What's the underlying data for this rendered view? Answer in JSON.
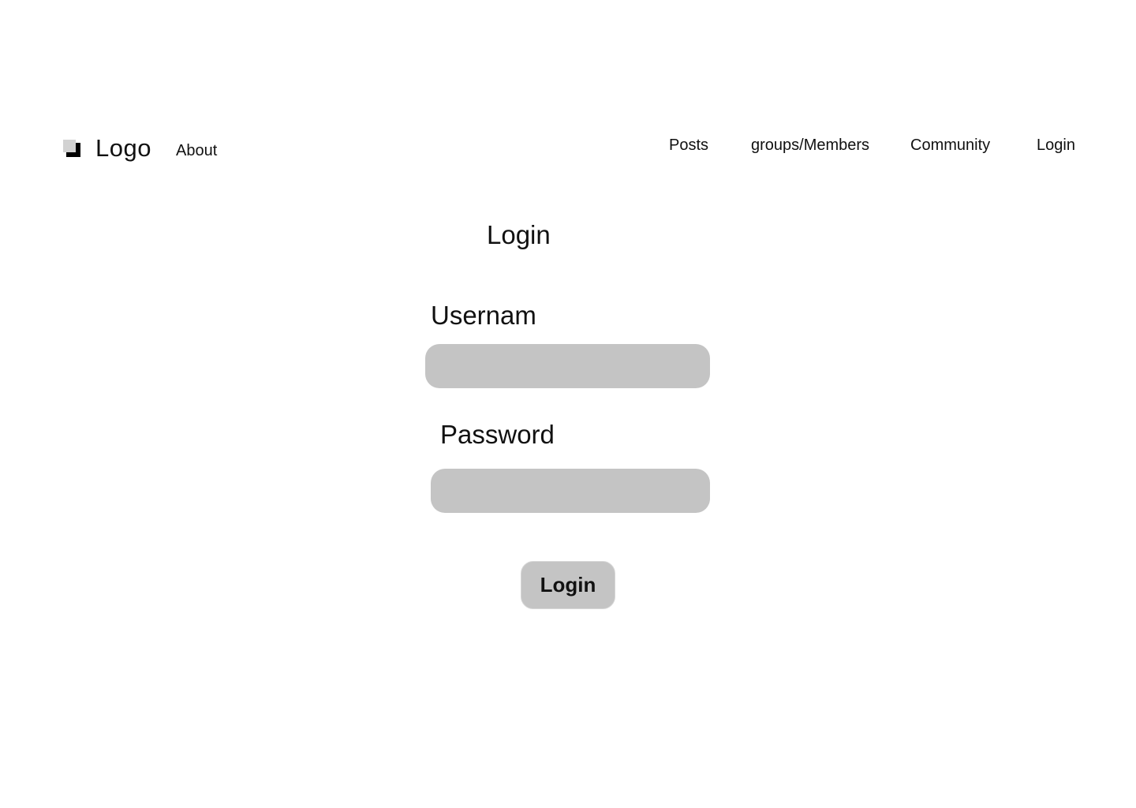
{
  "header": {
    "logo_text": "Logo",
    "logo_icon": "logo-mark-icon",
    "nav": {
      "about": "About",
      "posts": "Posts",
      "groups": "groups/Members",
      "community": "Community",
      "login": "Login"
    }
  },
  "main": {
    "title": "Login",
    "username": {
      "label": "Usernam",
      "value": "",
      "placeholder": ""
    },
    "password": {
      "label": "Password",
      "value": "",
      "placeholder": ""
    },
    "submit_label": "Login"
  },
  "colors": {
    "background": "#ffffff",
    "field_fill": "#c4c4c4",
    "button_fill": "#c4c4c4",
    "text": "#111111"
  }
}
